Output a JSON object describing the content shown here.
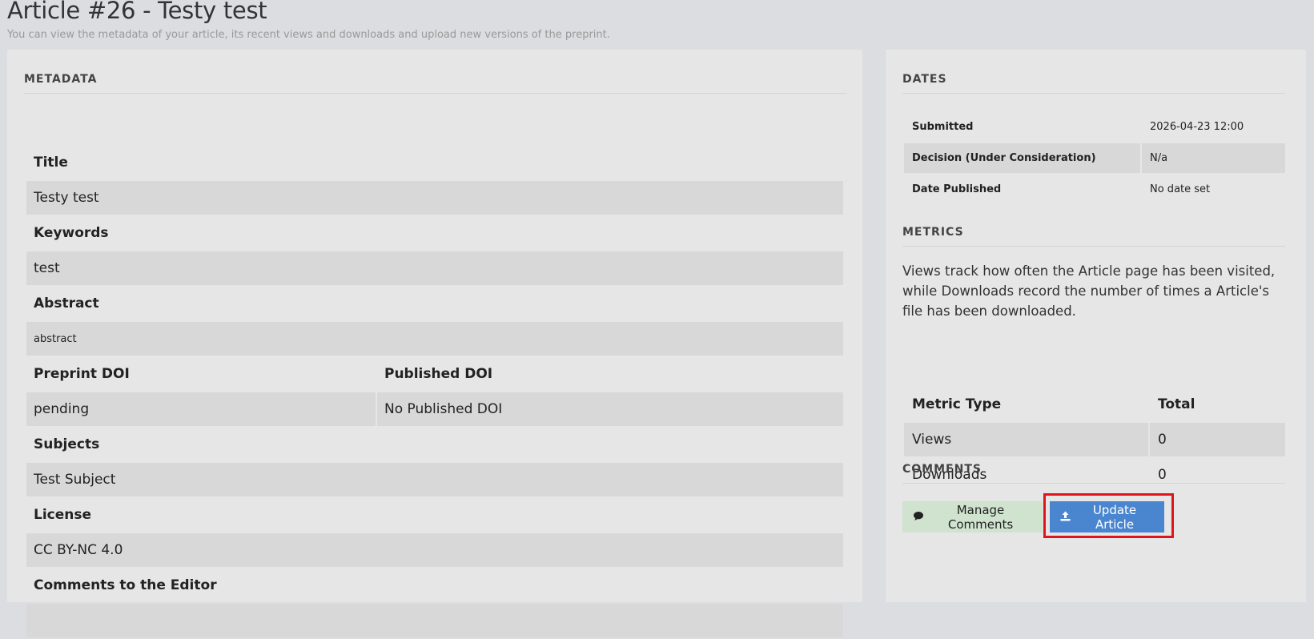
{
  "header": {
    "title": "Article #26 - Testy test",
    "subtitle": "You can view the metadata of your article, its recent views and downloads and upload new versions of the preprint."
  },
  "metadata": {
    "section_title": "METADATA",
    "title_label": "Title",
    "title_value": "Testy test",
    "keywords_label": "Keywords",
    "keywords_value": "test",
    "abstract_label": "Abstract",
    "abstract_value": "abstract",
    "preprint_doi_label": "Preprint DOI",
    "preprint_doi_value": "pending",
    "published_doi_label": "Published DOI",
    "published_doi_value": "No Published DOI",
    "subjects_label": "Subjects",
    "subjects_value": "Test Subject",
    "license_label": "License",
    "license_value": "CC BY-NC 4.0",
    "comments_editor_label": "Comments to the Editor",
    "comments_editor_value": ""
  },
  "dates": {
    "section_title": "DATES",
    "rows": [
      {
        "label": "Submitted",
        "value": "2026-04-23 12:00"
      },
      {
        "label": "Decision (Under Consideration)",
        "value": "N/a"
      },
      {
        "label": "Date Published",
        "value": "No date set"
      }
    ]
  },
  "metrics": {
    "section_title": "METRICS",
    "description": "Views track how often the Article page has been visited, while Downloads record the number of times a Article's file has been downloaded.",
    "col_type": "Metric Type",
    "col_total": "Total",
    "rows": [
      {
        "type": "Views",
        "total": "0"
      },
      {
        "type": "Downloads",
        "total": "0"
      }
    ]
  },
  "comments": {
    "section_title": "COMMENTS",
    "manage_label": "Manage Comments",
    "update_label": "Update Article"
  },
  "colors": {
    "update_button": "#4a86cf",
    "comments_button": "#cfe3cf",
    "highlight": "#e0141a"
  },
  "icons": {
    "manage": "comment-icon",
    "update": "upload-icon"
  }
}
